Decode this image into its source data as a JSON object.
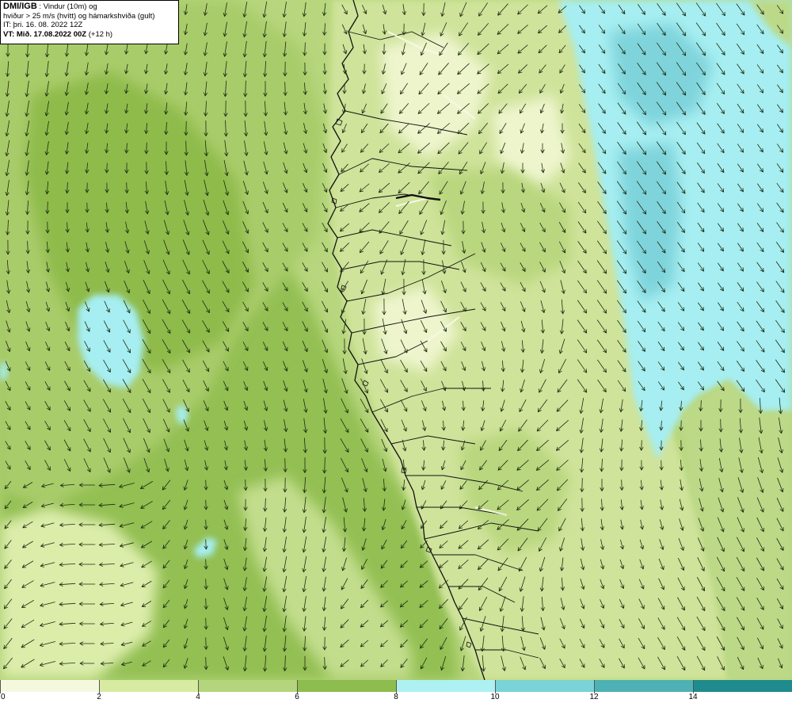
{
  "header": {
    "source": "DMI/IGB",
    "title_rest": " : Vindur (10m) og",
    "line2": "hviður > 25 m/s (hvítt) og hámarkshviða (gult)",
    "line3": "IT: þri. 16. 08. 2022 12Z",
    "line4_bold": "VT: Mið. 17.08.2022 00Z",
    "line4_rest": " (+12 h)"
  },
  "legend": {
    "bins": [
      {
        "from": 0,
        "to": 2,
        "color": "#f4f9de"
      },
      {
        "from": 2,
        "to": 4,
        "color": "#d7eba1"
      },
      {
        "from": 4,
        "to": 6,
        "color": "#b4d57b"
      },
      {
        "from": 6,
        "to": 8,
        "color": "#8dbd4e"
      },
      {
        "from": 8,
        "to": 10,
        "color": "#aef1f3"
      },
      {
        "from": 10,
        "to": 12,
        "color": "#79d3d7"
      },
      {
        "from": 12,
        "to": 14,
        "color": "#4db1b5"
      },
      {
        "from": 14,
        "to": 16,
        "color": "#1f8b8e"
      }
    ],
    "labels": [
      "0",
      "2",
      "4",
      "6",
      "8",
      "10",
      "12",
      "14"
    ]
  },
  "map_colors": {
    "ocean": "#a2c962",
    "inland": "#cfe39a",
    "calm": "#f2f7d4",
    "strong": "#7fe0e7",
    "coastline": "#111111",
    "arrow": "#1d2a10"
  }
}
